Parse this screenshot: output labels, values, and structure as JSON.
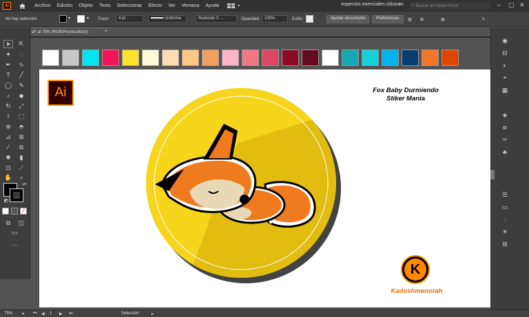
{
  "app": {
    "logo_text": "Ai"
  },
  "menu": {
    "items": [
      "Archivo",
      "Edición",
      "Objeto",
      "Texto",
      "Seleccionar",
      "Efecto",
      "Ver",
      "Ventana",
      "Ayuda"
    ],
    "workspace": "Aspectos esenciales clásicos",
    "stock_placeholder": "Buscar en Adobe Stock"
  },
  "control": {
    "selection": "No hay selección",
    "stroke_label": "Trazo:",
    "stroke_value": "4 pt",
    "stroke_profile": "Uniforme",
    "brush": "Redondo 3 ...",
    "opacity_label": "Opacidad:",
    "opacity_value": "100%",
    "style_label": "Estilo:",
    "doc_setup": "Ajustar documento",
    "preferences": "Preferencias"
  },
  "document": {
    "tab": "ai* al 75% (RGB/Previsualizar)"
  },
  "palette": [
    "#ffffff",
    "#c8c8c8",
    "#00e5ef",
    "#f0145a",
    "#ffe02a",
    "#fffbd6",
    "#ffdcb4",
    "#ffc882",
    "#f0a060",
    "#ffb4c8",
    "#f07882",
    "#dc4664",
    "#8c0a28",
    "#640a1e",
    "#ffffff",
    "#14aab4",
    "#14d2dc",
    "#00b4f0",
    "#0a3c6e",
    "#f07828",
    "#e04600"
  ],
  "artwork": {
    "ai_badge": "Ai",
    "title_line1": "Fox Baby Durmiendo",
    "title_line2": "Stiker Mania",
    "author": "Kadoshmenorah",
    "logo_letter": "K"
  },
  "status": {
    "zoom": "75%",
    "page": "1",
    "mode": "Selección"
  },
  "colors": {
    "accent": "#ff9a00",
    "fox_orange": "#f07a1e",
    "circle_yellow": "#f7d51d"
  }
}
